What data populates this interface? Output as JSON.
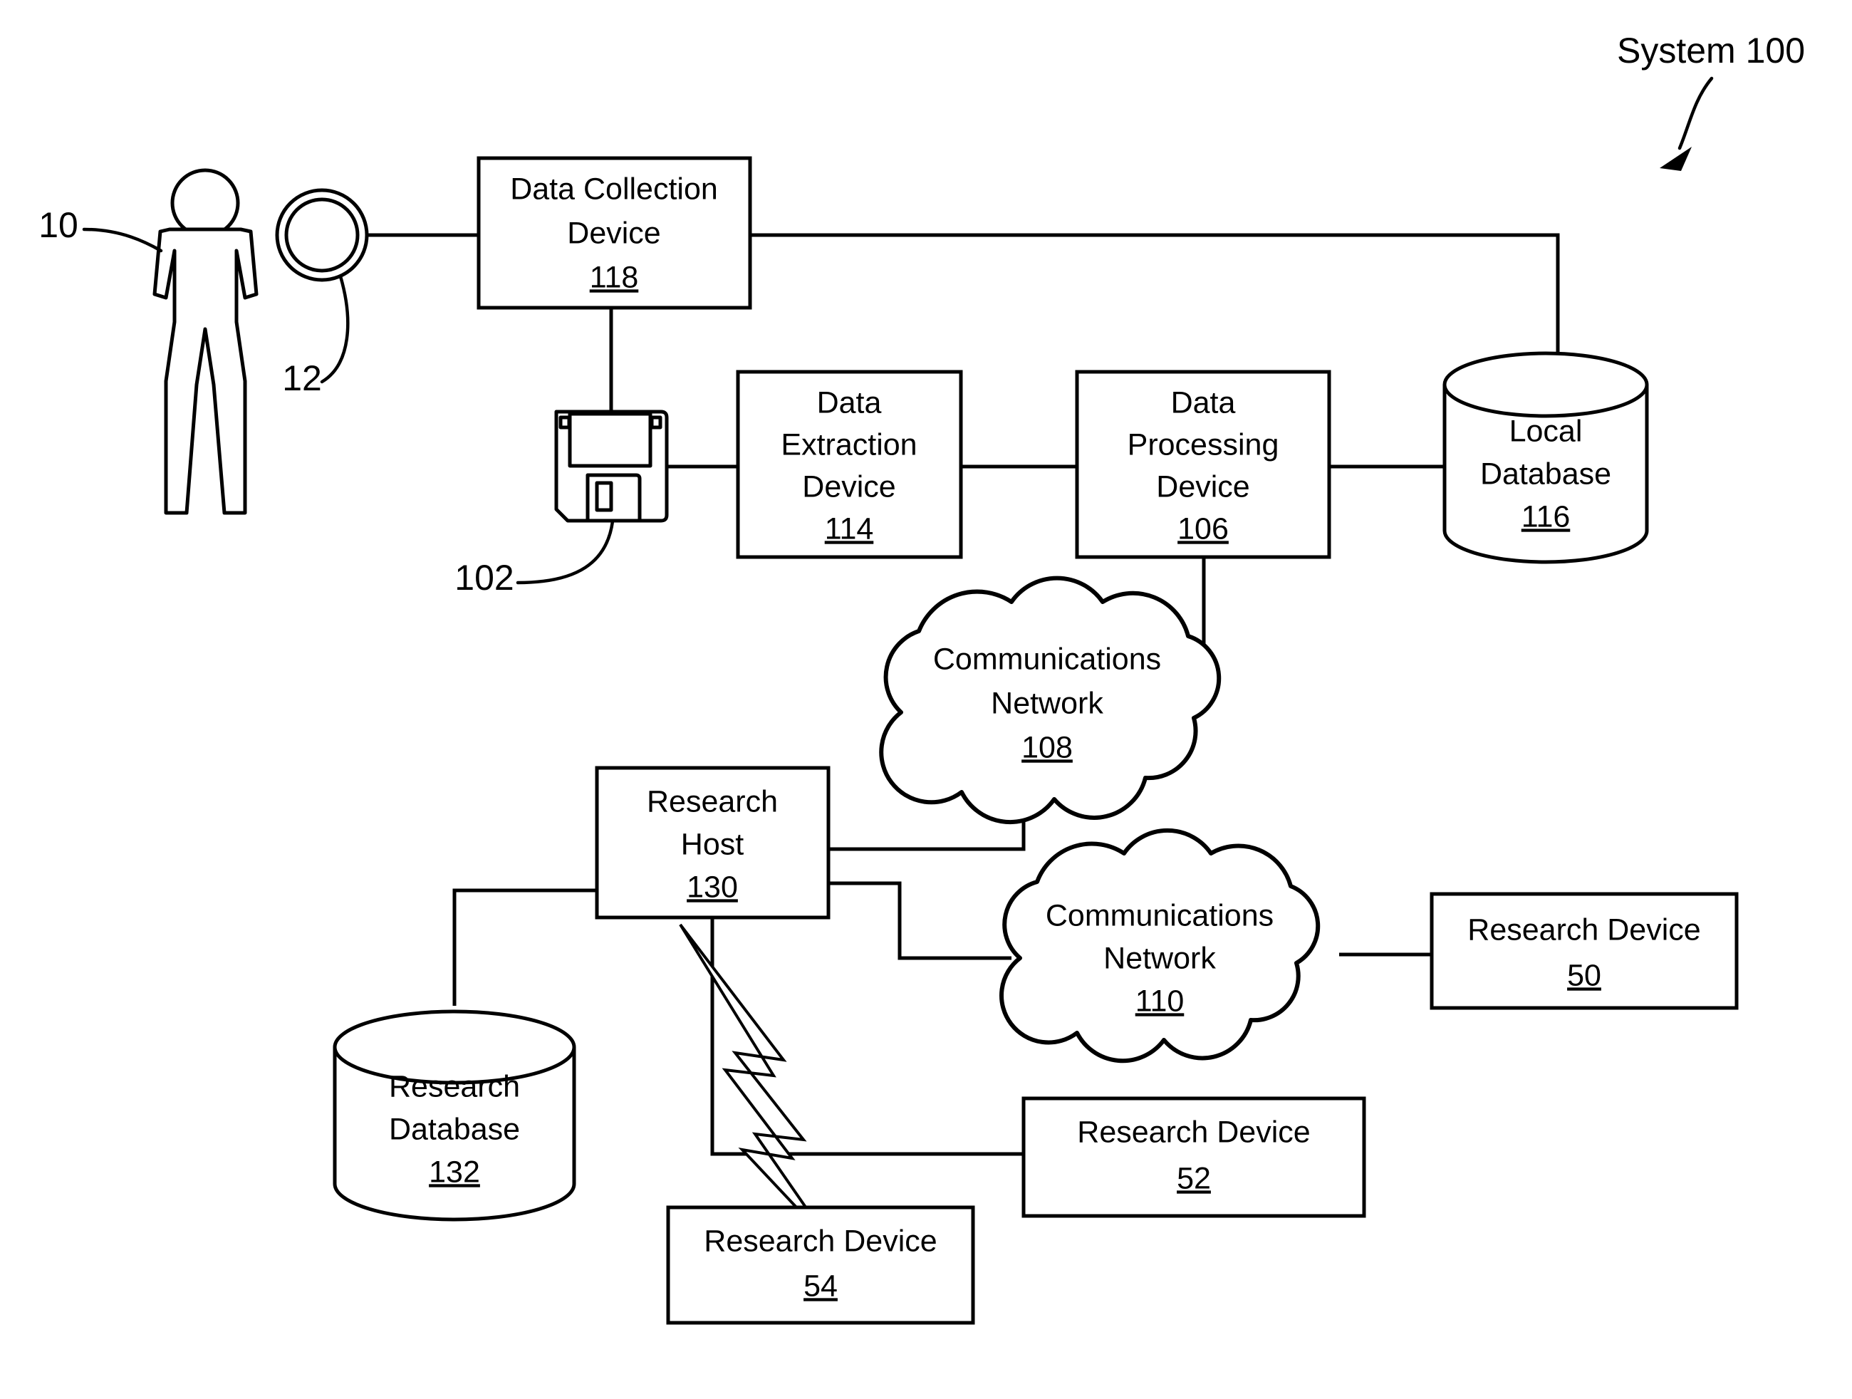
{
  "figure": {
    "title": "System 100",
    "title_label": "System 100"
  },
  "callouts": [
    {
      "name": "subject-callout",
      "label": "10"
    },
    {
      "name": "sensor-callout",
      "label": "12"
    },
    {
      "name": "storage-media-callout",
      "label": "102"
    }
  ],
  "nodes": {
    "data_collection_device": {
      "line1": "Data Collection",
      "line2": "Device",
      "ref": "118"
    },
    "data_extraction_device": {
      "line1": "Data",
      "line2": "Extraction",
      "line3": "Device",
      "ref": "114"
    },
    "data_processing_device": {
      "line1": "Data",
      "line2": "Processing",
      "line3": "Device",
      "ref": "106"
    },
    "local_database": {
      "line1": "Local",
      "line2": "Database",
      "ref": "116"
    },
    "communications_network_108": {
      "line1": "Communications",
      "line2": "Network",
      "ref": "108"
    },
    "communications_network_110": {
      "line1": "Communications",
      "line2": "Network",
      "ref": "110"
    },
    "research_host": {
      "line1": "Research",
      "line2": "Host",
      "ref": "130"
    },
    "research_database": {
      "line1": "Research",
      "line2": "Database",
      "ref": "132"
    },
    "research_device_50": {
      "line1": "Research Device",
      "ref": "50"
    },
    "research_device_52": {
      "line1": "Research Device",
      "ref": "52"
    },
    "research_device_54": {
      "line1": "Research Device",
      "ref": "54"
    }
  },
  "icons": {
    "subject": "person-figure-icon",
    "sensor": "ring-sensor-icon",
    "storage_media": "floppy-disk-icon",
    "wireless_link": "lightning-bolt-icon",
    "system_pointer": "curved-arrow-icon"
  },
  "colors": {
    "stroke": "#000000",
    "fill": "#ffffff",
    "background": "#ffffff"
  },
  "chart_data": {
    "type": "diagram",
    "title": "System 100",
    "nodes": [
      {
        "id": "10",
        "label": "Subject (person)",
        "shape": "person-figure"
      },
      {
        "id": "12",
        "label": "Sensor",
        "shape": "ring"
      },
      {
        "id": "118",
        "label": "Data Collection Device",
        "shape": "rect"
      },
      {
        "id": "102",
        "label": "Storage Media",
        "shape": "floppy-disk"
      },
      {
        "id": "114",
        "label": "Data Extraction Device",
        "shape": "rect"
      },
      {
        "id": "106",
        "label": "Data Processing Device",
        "shape": "rect"
      },
      {
        "id": "116",
        "label": "Local Database",
        "shape": "cylinder"
      },
      {
        "id": "108",
        "label": "Communications Network",
        "shape": "cloud"
      },
      {
        "id": "130",
        "label": "Research Host",
        "shape": "rect"
      },
      {
        "id": "132",
        "label": "Research Database",
        "shape": "cylinder"
      },
      {
        "id": "110",
        "label": "Communications Network",
        "shape": "cloud"
      },
      {
        "id": "50",
        "label": "Research Device",
        "shape": "rect"
      },
      {
        "id": "52",
        "label": "Research Device",
        "shape": "rect"
      },
      {
        "id": "54",
        "label": "Research Device",
        "shape": "rect"
      }
    ],
    "edges": [
      {
        "from": "10",
        "to": "12",
        "style": "solid"
      },
      {
        "from": "12",
        "to": "118",
        "style": "solid"
      },
      {
        "from": "118",
        "to": "116",
        "style": "solid"
      },
      {
        "from": "118",
        "to": "102",
        "style": "solid"
      },
      {
        "from": "102",
        "to": "114",
        "style": "solid"
      },
      {
        "from": "114",
        "to": "106",
        "style": "solid"
      },
      {
        "from": "106",
        "to": "116",
        "style": "solid"
      },
      {
        "from": "106",
        "to": "108",
        "style": "solid"
      },
      {
        "from": "108",
        "to": "130",
        "style": "solid"
      },
      {
        "from": "130",
        "to": "132",
        "style": "solid"
      },
      {
        "from": "130",
        "to": "110",
        "style": "solid"
      },
      {
        "from": "110",
        "to": "50",
        "style": "solid"
      },
      {
        "from": "130",
        "to": "52",
        "style": "solid"
      },
      {
        "from": "130",
        "to": "54",
        "style": "wireless"
      }
    ]
  }
}
